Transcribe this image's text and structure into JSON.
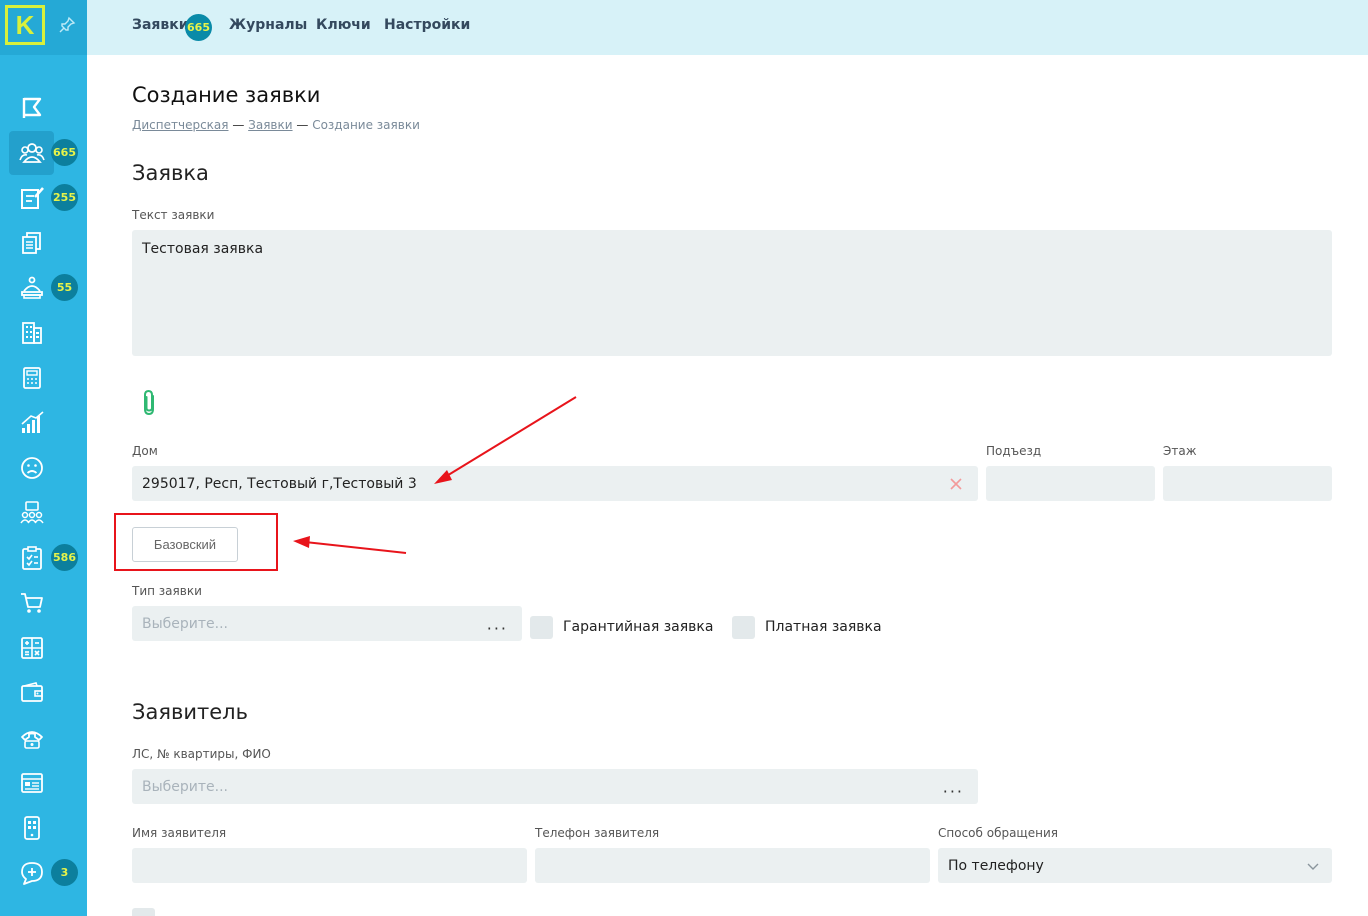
{
  "logo": {
    "letter": "K"
  },
  "topnav": {
    "items": [
      {
        "label": "Заявки",
        "badge": "665"
      },
      {
        "label": "Журналы"
      },
      {
        "label": "Ключи"
      },
      {
        "label": "Настройки"
      }
    ]
  },
  "sidebar": {
    "items": [
      {
        "icon": "flag-icon"
      },
      {
        "icon": "users-icon",
        "badge": "665",
        "active": true
      },
      {
        "icon": "edit-doc-icon",
        "badge": "255"
      },
      {
        "icon": "documents-icon"
      },
      {
        "icon": "service-icon",
        "badge": "55"
      },
      {
        "icon": "building-icon"
      },
      {
        "icon": "calculator-icon"
      },
      {
        "icon": "chart-icon"
      },
      {
        "icon": "sad-face-icon"
      },
      {
        "icon": "group-icon"
      },
      {
        "icon": "clipboard-icon",
        "badge": "586"
      },
      {
        "icon": "cart-icon"
      },
      {
        "icon": "calc-grid-icon"
      },
      {
        "icon": "wallet-icon"
      },
      {
        "icon": "phone-icon"
      },
      {
        "icon": "panel-icon"
      },
      {
        "icon": "mobile-icon"
      },
      {
        "icon": "chat-add-icon",
        "badge": "3"
      }
    ]
  },
  "page": {
    "title": "Создание заявки",
    "breadcrumb": {
      "items": [
        "Диспетчерская",
        "Заявки",
        "Создание заявки"
      ],
      "separator": "—"
    }
  },
  "request": {
    "section_title": "Заявка",
    "text_label": "Текст заявки",
    "text_value": "Тестовая заявка",
    "house_label": "Дом",
    "house_value": "295017, Респ, Тестовый г,Тестовый 3",
    "entrance_label": "Подъезд",
    "entrance_value": "",
    "floor_label": "Этаж",
    "floor_value": "",
    "basic_button": "Базовский",
    "type_label": "Тип заявки",
    "type_placeholder": "Выберите...",
    "warranty_label": "Гарантийная заявка",
    "paid_label": "Платная заявка"
  },
  "applicant": {
    "section_title": "Заявитель",
    "account_label": "ЛС, № квартиры, ФИО",
    "account_placeholder": "Выберите...",
    "name_label": "Имя заявителя",
    "name_value": "",
    "phone_label": "Телефон заявителя",
    "phone_value": "",
    "method_label": "Способ обращения",
    "method_value": "По телефону"
  },
  "colors": {
    "sidebar": "#2eb6e3",
    "topnav": "#d7f2f8",
    "badge": "#0a8aa8",
    "badge_text": "#e6f34a",
    "field": "#ebf0f1",
    "annotation": "#e8141b",
    "clip": "#2fb872"
  }
}
